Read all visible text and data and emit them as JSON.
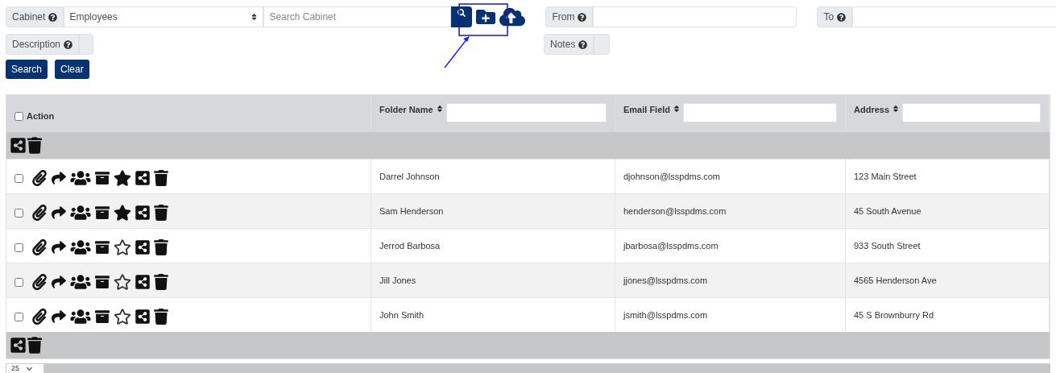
{
  "search_form": {
    "cabinet": {
      "label": "Cabinet",
      "value": "Employees"
    },
    "search_field": {
      "placeholder": "Search Cabinet"
    },
    "from": {
      "label": "From"
    },
    "to": {
      "label": "To"
    },
    "description": {
      "label": "Description"
    },
    "notes": {
      "label": "Notes"
    },
    "buttons": [
      "Search",
      "Clear"
    ]
  },
  "table": {
    "select_all": {
      "label": "Action",
      "checked": false
    },
    "columns": [
      "Folder Name",
      "Email Field",
      "Address"
    ],
    "rows": [
      {
        "checked": false,
        "starred": true,
        "cells": [
          "Darrel Johnson",
          "djohnson@lsspdms.com",
          "123 Main Street"
        ]
      },
      {
        "checked": false,
        "starred": true,
        "cells": [
          "Sam Henderson",
          "henderson@lsspdms.com",
          "45 South Avenue"
        ]
      },
      {
        "checked": false,
        "starred": false,
        "cells": [
          "Jerrod Barbosa",
          "jbarbosa@lsspdms.com",
          "933 South Street"
        ]
      },
      {
        "checked": false,
        "starred": false,
        "cells": [
          "Jill Jones",
          "jjones@lsspdms.com",
          "4565 Henderson Ave"
        ]
      },
      {
        "checked": false,
        "starred": false,
        "cells": [
          "John Smith",
          "jsmith@lsspdms.com",
          "45 S Brownburry Rd"
        ]
      }
    ]
  },
  "pagination": {
    "page_size": "25"
  }
}
